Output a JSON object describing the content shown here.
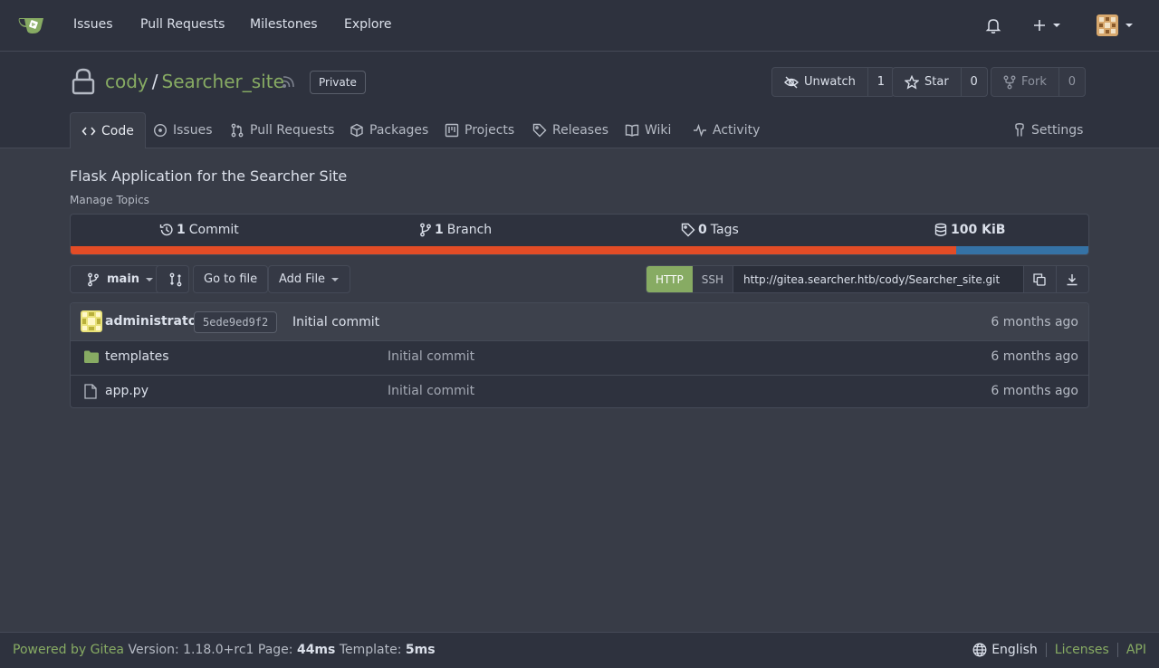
{
  "nav": {
    "items": [
      "Issues",
      "Pull Requests",
      "Milestones",
      "Explore"
    ]
  },
  "repo": {
    "owner": "cody",
    "separator": "/",
    "name": "Searcher_site",
    "visibility": "Private",
    "actions": {
      "watch_label": "Unwatch",
      "watch_count": "1",
      "star_label": "Star",
      "star_count": "0",
      "fork_label": "Fork",
      "fork_count": "0"
    },
    "tabs": [
      "Code",
      "Issues",
      "Pull Requests",
      "Packages",
      "Projects",
      "Releases",
      "Wiki",
      "Activity"
    ],
    "settings_label": "Settings",
    "description": "Flask Application for the Searcher Site",
    "manage_topics": "Manage Topics"
  },
  "stats": {
    "commits_count": "1",
    "commits_label": "Commit",
    "branches_count": "1",
    "branches_label": "Branch",
    "tags_count": "0",
    "tags_label": "Tags",
    "size": "100 KiB"
  },
  "languages": [
    {
      "color": "#e34c26",
      "fraction": 0.87
    },
    {
      "color": "#3572a5",
      "fraction": 0.13
    }
  ],
  "toolbar": {
    "branch": "main",
    "goto_file": "Go to file",
    "add_file": "Add File",
    "clone_http": "HTTP",
    "clone_ssh": "SSH",
    "clone_url": "http://gitea.searcher.htb/cody/Searcher_site.git"
  },
  "latest_commit": {
    "author": "administrator",
    "sha": "5ede9ed9f2",
    "message": "Initial commit",
    "time": "6 months ago"
  },
  "files": [
    {
      "name": "templates",
      "type": "folder",
      "message": "Initial commit",
      "time": "6 months ago"
    },
    {
      "name": "app.py",
      "type": "file",
      "message": "Initial commit",
      "time": "6 months ago"
    }
  ],
  "footer": {
    "powered_by": "Powered by Gitea",
    "version_text": "Version: 1.18.0+rc1 Page:",
    "page_time": "44ms",
    "template_label": "Template:",
    "template_time": "5ms",
    "language": "English",
    "licenses": "Licenses",
    "api": "API"
  },
  "colors": {
    "accent": "#87ab63",
    "background": "#383c47",
    "header": "#2e323e"
  }
}
